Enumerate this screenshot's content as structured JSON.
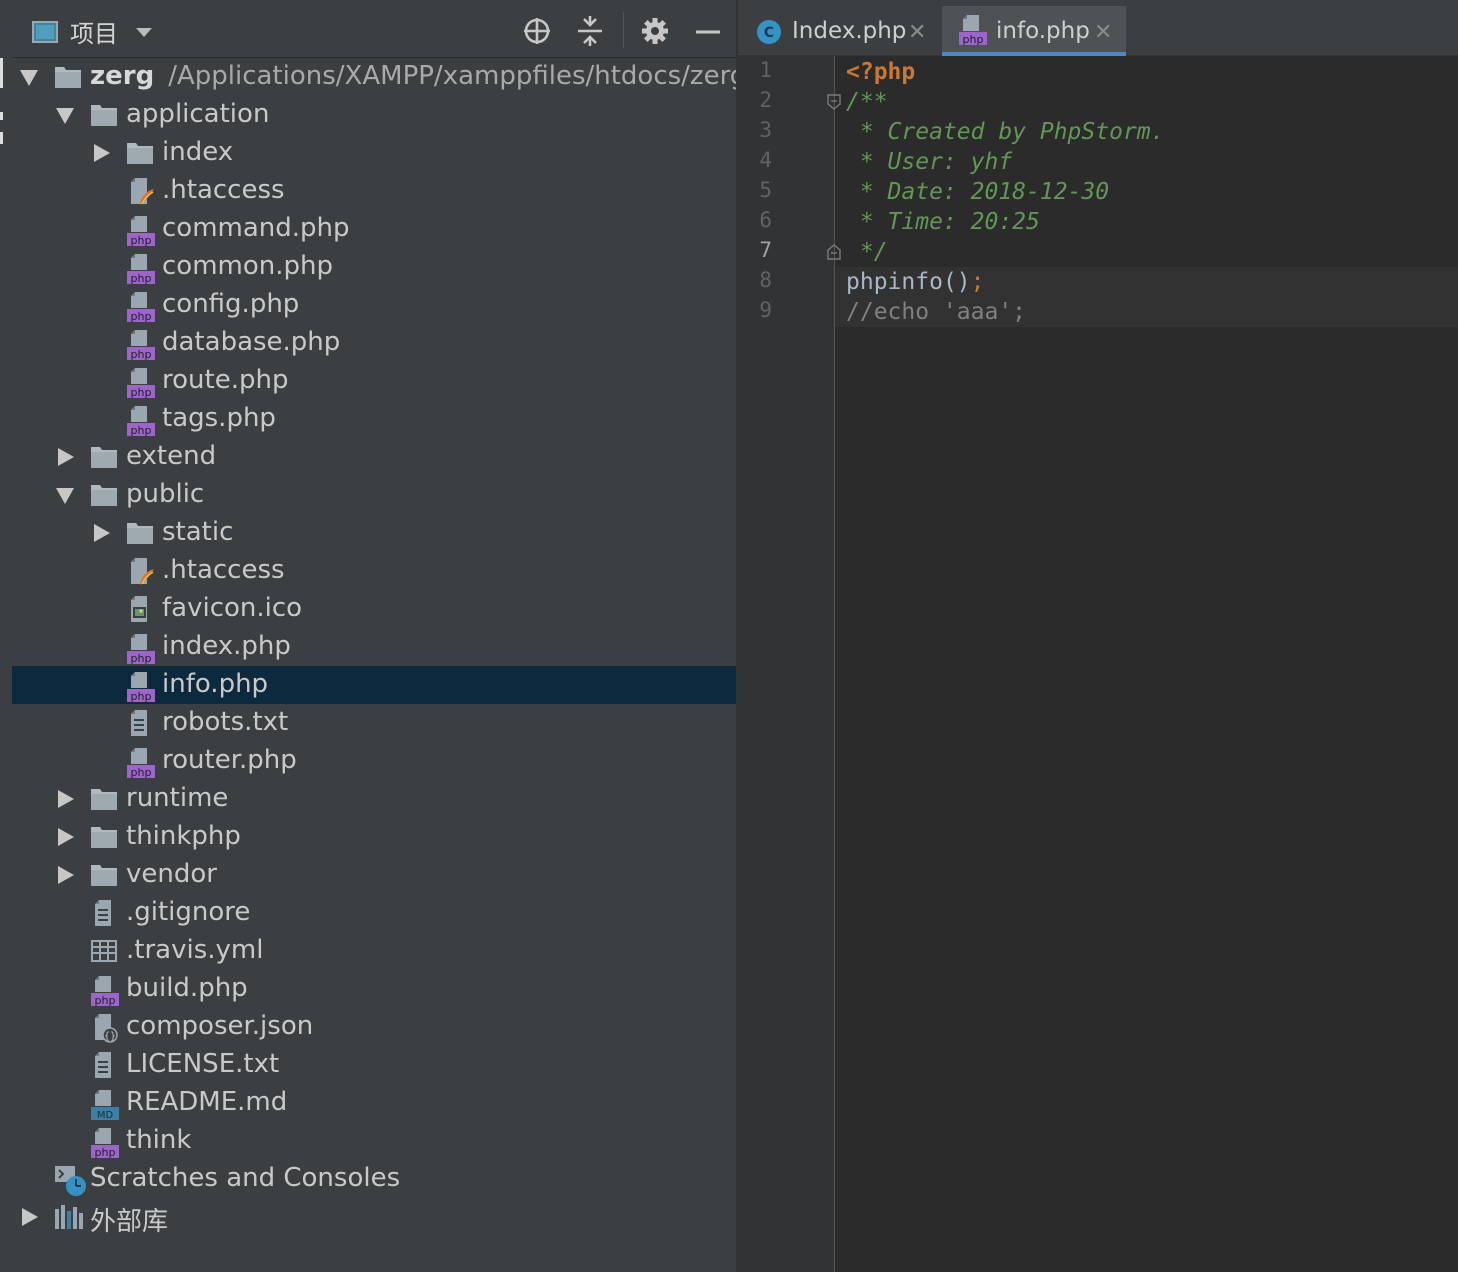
{
  "project_panel": {
    "title": "项目",
    "tree": [
      {
        "label": "zerg",
        "path": "/Applications/XAMPP/xamppfiles/htdocs/zerg",
        "type": "folder",
        "depth": 0,
        "toggle": "open",
        "bold": true
      },
      {
        "label": "application",
        "type": "folder",
        "depth": 1,
        "toggle": "open"
      },
      {
        "label": "index",
        "type": "folder",
        "depth": 2,
        "toggle": "closed"
      },
      {
        "label": ".htaccess",
        "type": "htaccess",
        "depth": 2
      },
      {
        "label": "command.php",
        "type": "php",
        "depth": 2
      },
      {
        "label": "common.php",
        "type": "php",
        "depth": 2
      },
      {
        "label": "config.php",
        "type": "php",
        "depth": 2
      },
      {
        "label": "database.php",
        "type": "php",
        "depth": 2
      },
      {
        "label": "route.php",
        "type": "php",
        "depth": 2
      },
      {
        "label": "tags.php",
        "type": "php",
        "depth": 2
      },
      {
        "label": "extend",
        "type": "folder",
        "depth": 1,
        "toggle": "closed"
      },
      {
        "label": "public",
        "type": "folder",
        "depth": 1,
        "toggle": "open"
      },
      {
        "label": "static",
        "type": "folder",
        "depth": 2,
        "toggle": "closed"
      },
      {
        "label": ".htaccess",
        "type": "htaccess",
        "depth": 2
      },
      {
        "label": "favicon.ico",
        "type": "image",
        "depth": 2
      },
      {
        "label": "index.php",
        "type": "php",
        "depth": 2
      },
      {
        "label": "info.php",
        "type": "php",
        "depth": 2,
        "selected": true
      },
      {
        "label": "robots.txt",
        "type": "text",
        "depth": 2
      },
      {
        "label": "router.php",
        "type": "php",
        "depth": 2
      },
      {
        "label": "runtime",
        "type": "folder",
        "depth": 1,
        "toggle": "closed"
      },
      {
        "label": "thinkphp",
        "type": "folder",
        "depth": 1,
        "toggle": "closed"
      },
      {
        "label": "vendor",
        "type": "folder",
        "depth": 1,
        "toggle": "closed"
      },
      {
        "label": ".gitignore",
        "type": "text",
        "depth": 1
      },
      {
        "label": ".travis.yml",
        "type": "yml",
        "depth": 1
      },
      {
        "label": "build.php",
        "type": "php",
        "depth": 1
      },
      {
        "label": "composer.json",
        "type": "json",
        "depth": 1
      },
      {
        "label": "LICENSE.txt",
        "type": "text",
        "depth": 1
      },
      {
        "label": "README.md",
        "type": "md",
        "depth": 1
      },
      {
        "label": "think",
        "type": "php",
        "depth": 1
      },
      {
        "label": "Scratches and Consoles",
        "type": "scratches",
        "depth": 0
      },
      {
        "label": "外部库",
        "type": "library",
        "depth": 0,
        "toggle": "closed"
      }
    ]
  },
  "editor": {
    "tabs": [
      {
        "label": "Index.php",
        "icon": "class-icon",
        "active": false
      },
      {
        "label": "info.php",
        "icon": "php-file-icon",
        "active": true
      }
    ],
    "current_line": 7,
    "lines": [
      [
        {
          "t": "<?php",
          "c": "k-tag"
        }
      ],
      [
        {
          "t": "/**",
          "c": "k-doc"
        }
      ],
      [
        {
          "t": " * Created by PhpStorm.",
          "c": "k-doc"
        }
      ],
      [
        {
          "t": " * User: yhf",
          "c": "k-doc"
        }
      ],
      [
        {
          "t": " * Date: 2018-12-30",
          "c": "k-doc"
        }
      ],
      [
        {
          "t": " * Time: 20:25",
          "c": "k-doc"
        }
      ],
      [
        {
          "t": " */",
          "c": "k-doc"
        }
      ],
      [
        {
          "t": "phpinfo",
          "c": "k-fn"
        },
        {
          "t": "()",
          "c": "k-punc"
        },
        {
          "t": ";",
          "c": "k-semi"
        }
      ],
      [
        {
          "t": "//echo 'aaa';",
          "c": "k-cmt"
        }
      ]
    ]
  }
}
